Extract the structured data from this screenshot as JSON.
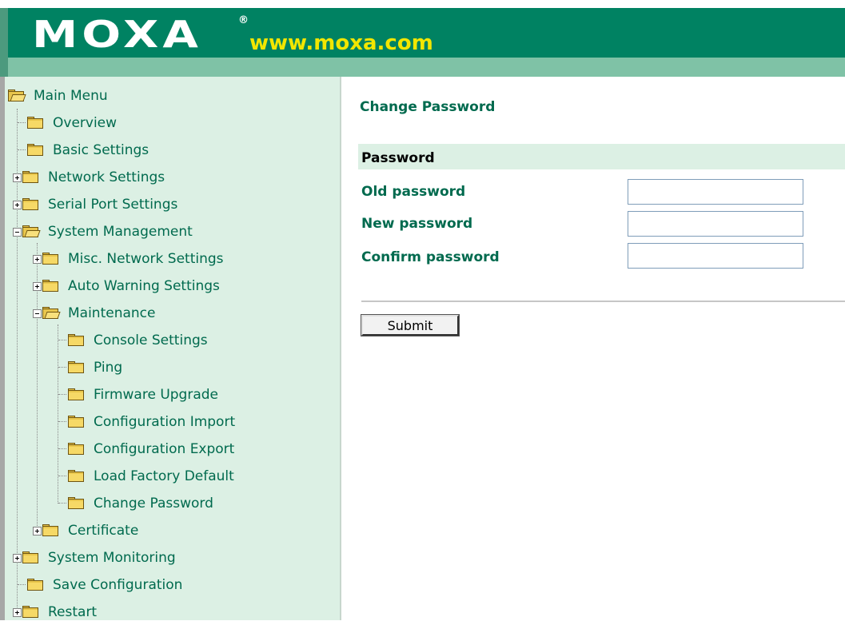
{
  "header": {
    "logo_text": "MOXA",
    "logo_reg": "®",
    "url_text": "www.moxa.com"
  },
  "sidebar": {
    "items": [
      {
        "label": "Main Menu"
      },
      {
        "label": "Overview"
      },
      {
        "label": "Basic Settings"
      },
      {
        "label": "Network Settings"
      },
      {
        "label": "Serial Port Settings"
      },
      {
        "label": "System Management"
      },
      {
        "label": "Misc. Network Settings"
      },
      {
        "label": "Auto Warning Settings"
      },
      {
        "label": "Maintenance"
      },
      {
        "label": "Console Settings"
      },
      {
        "label": "Ping"
      },
      {
        "label": "Firmware Upgrade"
      },
      {
        "label": "Configuration Import"
      },
      {
        "label": "Configuration Export"
      },
      {
        "label": "Load Factory Default"
      },
      {
        "label": "Change Password"
      },
      {
        "label": "Certificate"
      },
      {
        "label": "System Monitoring"
      },
      {
        "label": "Save Configuration"
      },
      {
        "label": "Restart"
      }
    ]
  },
  "main": {
    "title": "Change Password",
    "section_title": "Password",
    "fields": [
      {
        "label": "Old password",
        "value": ""
      },
      {
        "label": "New password",
        "value": ""
      },
      {
        "label": "Confirm password",
        "value": ""
      }
    ],
    "submit_label": "Submit"
  },
  "colors": {
    "header_green": "#008262",
    "header_light": "#7fc2a6",
    "sidebar_bg": "#dcf0e4",
    "text_green": "#006a4e",
    "url_yellow": "#f2e600"
  }
}
